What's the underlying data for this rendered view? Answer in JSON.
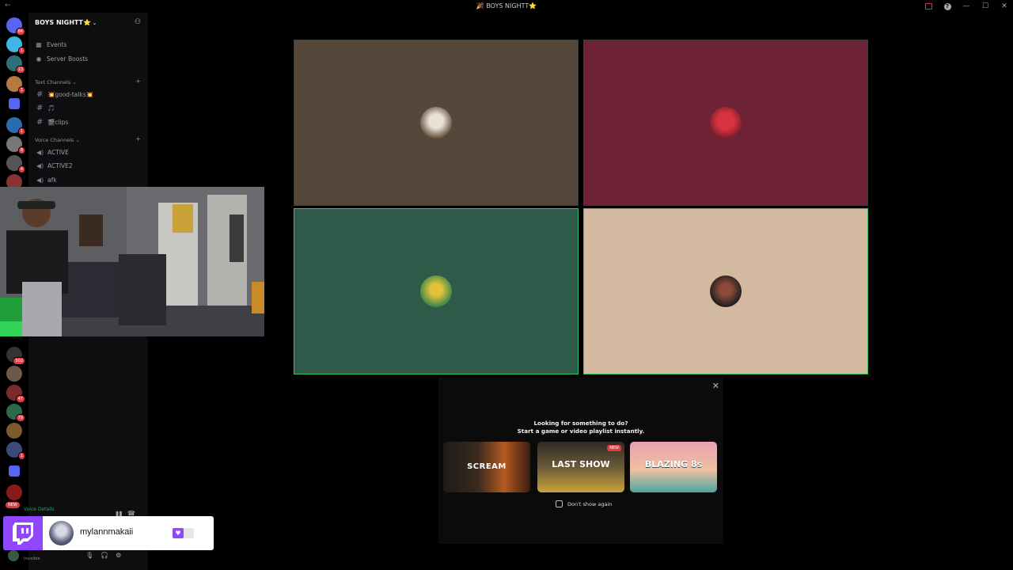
{
  "window": {
    "title": "🎉 BOYS NIGHTT⭐"
  },
  "rail": {
    "badges": [
      "84",
      "1",
      "13",
      "1",
      "1",
      "8",
      "4",
      "502",
      "47",
      "79",
      "1"
    ],
    "new_label": "NEW"
  },
  "sidebar": {
    "server_name": "BOYS NIGHTT⭐",
    "items": [
      {
        "label": "Events"
      },
      {
        "label": "Server Boosts"
      }
    ],
    "text_category": "Text Channels",
    "text_channels": [
      "💥good-talks💥",
      "🎵",
      "🎬clips"
    ],
    "voice_category": "Voice Channels",
    "voice_channels": [
      "ACTIVE",
      "ACTIVE2",
      "afk"
    ],
    "voice_details": "Voice Details",
    "user_status": "Invisible"
  },
  "twitch": {
    "username": "mylannmakaii"
  },
  "activity": {
    "line1": "Looking for something to do?",
    "line2": "Start a game or video playlist instantly.",
    "cards": [
      {
        "title": "SCREAM"
      },
      {
        "title": "LAST SHOW",
        "badge": "NEW"
      },
      {
        "title": "BLAZING 8s"
      }
    ],
    "dont_show": "Don't show again"
  },
  "colors": {
    "tile1": "#55473a",
    "tile2": "#6d2335",
    "tile3": "#2f5a4a",
    "tile4": "#d3b9a0",
    "speaking": "#2dc770",
    "twitch_purple": "#9146ff",
    "badge_red": "#e23b43"
  }
}
